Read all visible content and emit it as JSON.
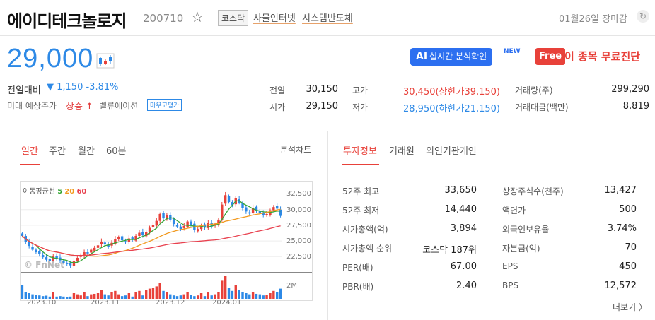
{
  "header": {
    "name": "에이디테크놀로지",
    "code": "200710",
    "market_tag": "코스닥",
    "sector_tags": [
      "사물인터넷",
      "시스템반도체"
    ],
    "date_status": "01월26일 장마감"
  },
  "price": {
    "current": "29,000",
    "change_label": "전일대비",
    "change_value": "▼ 1,150 -3.81%",
    "future_label": "미래 예상주가",
    "future_value": "상승 ↑",
    "valuation_label": "벨류에이션",
    "valuation_button": "마우고평가"
  },
  "promo": {
    "ai_strong": "AI",
    "ai_label": "실시간 분석확인",
    "new_tag": "NEW",
    "free_tag": "Free",
    "free_text": "이 종목 무료진단"
  },
  "quote": {
    "prev_label": "전일",
    "prev_value": "30,150",
    "open_label": "시가",
    "open_value": "29,150",
    "high_label": "고가",
    "high_value": "30,450(상한가39,150)",
    "low_label": "저가",
    "low_value": "28,950(하한가21,150)",
    "volume_label": "거래량(주)",
    "volume_value": "299,290",
    "amount_label": "거래대금(백만)",
    "amount_value": "8,819"
  },
  "chart_tabs": [
    "일간",
    "주간",
    "월간",
    "60분"
  ],
  "chart_link": "분석차트",
  "info_tabs": [
    "투자정보",
    "거래원",
    "외인기관개인"
  ],
  "chart_data": {
    "type": "candlestick",
    "ma_label": "이동평균선",
    "ma_periods": [
      "5",
      "20",
      "60"
    ],
    "ma_colors": [
      "#35a635",
      "#f29a1f",
      "#e8414f"
    ],
    "y_ticks": [
      "32,500",
      "30,000",
      "27,500",
      "25,000",
      "22,500"
    ],
    "y_range": [
      20500,
      33800
    ],
    "volume_tick": "2M",
    "x_ticks": [
      "2023.10",
      "2023.11",
      "2023.12",
      "2024.01"
    ],
    "watermark": "© FnNet",
    "closes": [
      25800,
      24800,
      24200,
      23600,
      23200,
      22900,
      22400,
      22000,
      21800,
      22600,
      22200,
      21900,
      21500,
      21300,
      21100,
      21800,
      22300,
      22700,
      23200,
      23000,
      23600,
      23900,
      24300,
      24900,
      24500,
      24100,
      24700,
      25300,
      25600,
      25100,
      24800,
      25400,
      25200,
      25800,
      26300,
      25900,
      26400,
      27100,
      27600,
      28200,
      29300,
      28600,
      29100,
      28400,
      27700,
      27300,
      26900,
      27400,
      28100,
      27600,
      26700,
      26900,
      27500,
      27200,
      27900,
      27300,
      27700,
      28400,
      30800,
      32300,
      31200,
      30700,
      31800,
      31100,
      30200,
      29700,
      29400,
      30300,
      29900,
      29500,
      29100,
      29300,
      29900,
      30400,
      30150,
      29000
    ],
    "volumes": [
      0.6,
      0.3,
      0.25,
      0.2,
      0.18,
      0.15,
      0.12,
      0.14,
      0.1,
      0.3,
      0.1,
      0.12,
      0.1,
      0.08,
      0.1,
      0.25,
      0.2,
      0.15,
      0.3,
      0.12,
      0.2,
      0.22,
      0.25,
      0.4,
      0.2,
      0.15,
      0.3,
      0.35,
      0.2,
      0.12,
      0.15,
      0.25,
      0.1,
      0.3,
      0.35,
      0.15,
      0.4,
      0.45,
      0.5,
      0.55,
      0.7,
      0.35,
      0.3,
      0.2,
      0.15,
      0.12,
      0.15,
      0.2,
      0.3,
      0.18,
      0.12,
      0.15,
      0.25,
      0.12,
      0.28,
      0.15,
      0.2,
      0.3,
      0.8,
      1.0,
      0.5,
      0.35,
      0.6,
      0.4,
      0.3,
      0.25,
      0.2,
      0.3,
      0.22,
      0.2,
      0.15,
      0.18,
      0.25,
      0.35,
      0.3,
      0.45
    ]
  },
  "invest_info": {
    "left": [
      {
        "label": "52주 최고",
        "value": "33,650"
      },
      {
        "label": "52주 최저",
        "value": "14,440"
      },
      {
        "label": "시가총액(억)",
        "value": "3,894"
      },
      {
        "label": "시가총액 순위",
        "value": "코스닥 187위"
      },
      {
        "label": "PER(배)",
        "value": "67.00"
      },
      {
        "label": "PBR(배)",
        "value": "2.40"
      }
    ],
    "right": [
      {
        "label": "상장주식수(천주)",
        "value": "13,427"
      },
      {
        "label": "액면가",
        "value": "500"
      },
      {
        "label": "외국인보유율",
        "value": "3.74%"
      },
      {
        "label": "자본금(억)",
        "value": "70"
      },
      {
        "label": "EPS",
        "value": "450"
      },
      {
        "label": "BPS",
        "value": "12,572"
      }
    ],
    "more_link": "더보기 〉"
  },
  "colors": {
    "up": "#e8413a",
    "down": "#2d89e6"
  }
}
